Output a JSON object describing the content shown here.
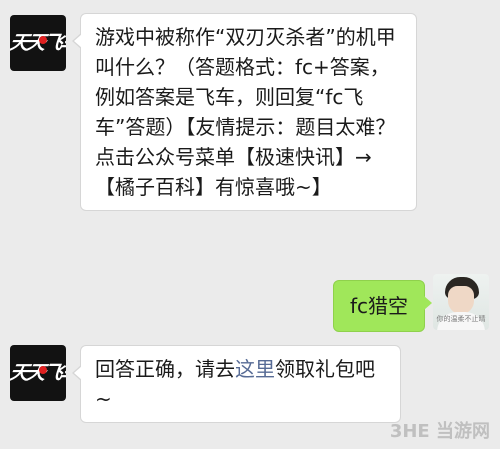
{
  "messages": [
    {
      "side": "left",
      "avatar_icon": "qq-speed-logo-icon",
      "text": "游戏中被称作“双刃灭杀者”的机甲叫什么？（答题格式：fc+答案，例如答案是飞车，则回复“fc飞车”答题）【友情提示：题目太难？点击公众号菜单【极速快讯】→【橘子百科】有惊喜哦~】"
    },
    {
      "side": "right",
      "avatar_icon": "user-avatar-photo-icon",
      "avatar_caption": "你的温柔不止晴",
      "text": "fc猎空"
    },
    {
      "side": "left",
      "avatar_icon": "qq-speed-logo-icon",
      "text_before": "回答正确，请去",
      "link_text": "这里",
      "text_after": "领取礼包吧~"
    }
  ],
  "logo": {
    "text": "天天飞车"
  },
  "watermark": "3HE 当游网",
  "colors": {
    "background": "#ebebeb",
    "bubble_left": "#ffffff",
    "bubble_right": "#a0e75a",
    "link": "#576b95"
  }
}
